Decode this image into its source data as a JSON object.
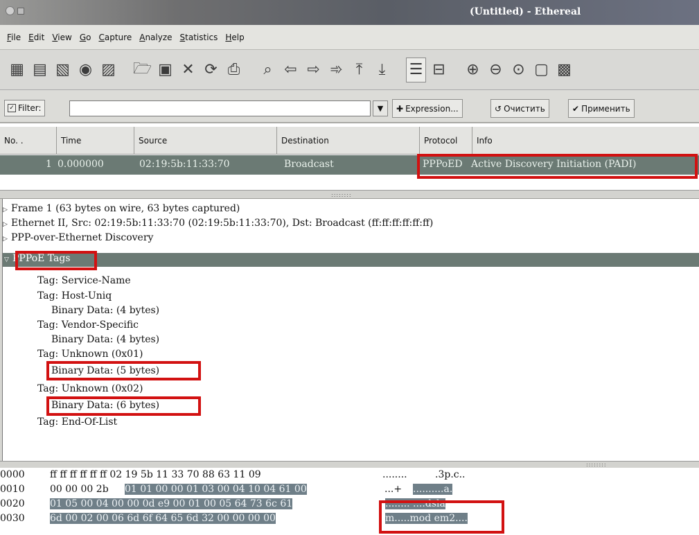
{
  "window": {
    "title": "(Untitled) - Ethereal"
  },
  "menubar": {
    "items": [
      "File",
      "Edit",
      "View",
      "Go",
      "Capture",
      "Analyze",
      "Statistics",
      "Help"
    ]
  },
  "toolbar": {
    "icons": [
      "interface-list-icon",
      "capture-options-icon",
      "start-capture-icon",
      "stop-capture-icon",
      "restart-capture-icon",
      "open-file-icon",
      "save-file-icon",
      "close-file-icon",
      "reload-icon",
      "print-icon",
      "find-packet-icon",
      "go-back-icon",
      "go-forward-icon",
      "go-to-packet-icon",
      "go-first-icon",
      "go-last-icon",
      "colorize-icon",
      "auto-scroll-icon",
      "zoom-in-icon",
      "zoom-out-icon",
      "zoom-normal-icon",
      "resize-columns-icon",
      "capture-filters-icon"
    ]
  },
  "filter": {
    "label": "Filter:",
    "value": "",
    "expression_label": "Expression...",
    "clear_label": "Очистить",
    "apply_label": "Применить"
  },
  "packet_list": {
    "columns": [
      "No. .",
      "Time",
      "Source",
      "Destination",
      "Protocol",
      "Info"
    ],
    "rows": [
      {
        "no": "1",
        "time": "0.000000",
        "source": "02:19:5b:11:33:70",
        "destination": "Broadcast",
        "protocol": "PPPoED",
        "info": "Active Discovery Initiation (PADI)"
      }
    ]
  },
  "details": {
    "frame": "Frame 1 (63 bytes on wire, 63 bytes captured)",
    "ethernet": "Ethernet II, Src: 02:19:5b:11:33:70 (02:19:5b:11:33:70), Dst: Broadcast (ff:ff:ff:ff:ff:ff)",
    "pppoe": "PPP-over-Ethernet Discovery",
    "tags_header": "PPPoE Tags",
    "tags": [
      "Tag: Service-Name",
      "Tag: Host-Uniq",
      "Binary Data: (4 bytes)",
      "Tag: Vendor-Specific",
      "Binary Data: (4 bytes)",
      "Tag: Unknown (0x01)",
      "Binary Data: (5 bytes)",
      "Tag: Unknown (0x02)",
      "Binary Data: (6 bytes)",
      "Tag: End-Of-List"
    ]
  },
  "hex": {
    "rows": [
      {
        "offset": "0000",
        "plain": "ff ff ff ff ff ff 02 19  5b 11 33 70 88 63 11 09",
        "hl": "",
        "ascii_plain": "........ ",
        "ascii_hl": "",
        "ascii_tail": ".3p.c.."
      },
      {
        "offset": "0010",
        "plain": "00 00 00 2b ",
        "hl": "01 01 00 00  01 03 00 04 10 04 61 00",
        "ascii_plain": "...+",
        "ascii_hl": "..........a.",
        "ascii_tail": ""
      },
      {
        "offset": "0020",
        "plain": "",
        "hl": "01 05 00 04 00 00 0d e9  00 01 00 05 64 73 6c 61",
        "ascii_plain": "",
        "ascii_hl": "........ ....dsla",
        "ascii_tail": ""
      },
      {
        "offset": "0030",
        "plain": "",
        "hl": "6d 00 02 00 06 6d 6f 64  65 6d 32 00 00 00 00",
        "ascii_plain": "",
        "ascii_hl": "m.....mod em2....",
        "ascii_tail": ""
      }
    ]
  }
}
